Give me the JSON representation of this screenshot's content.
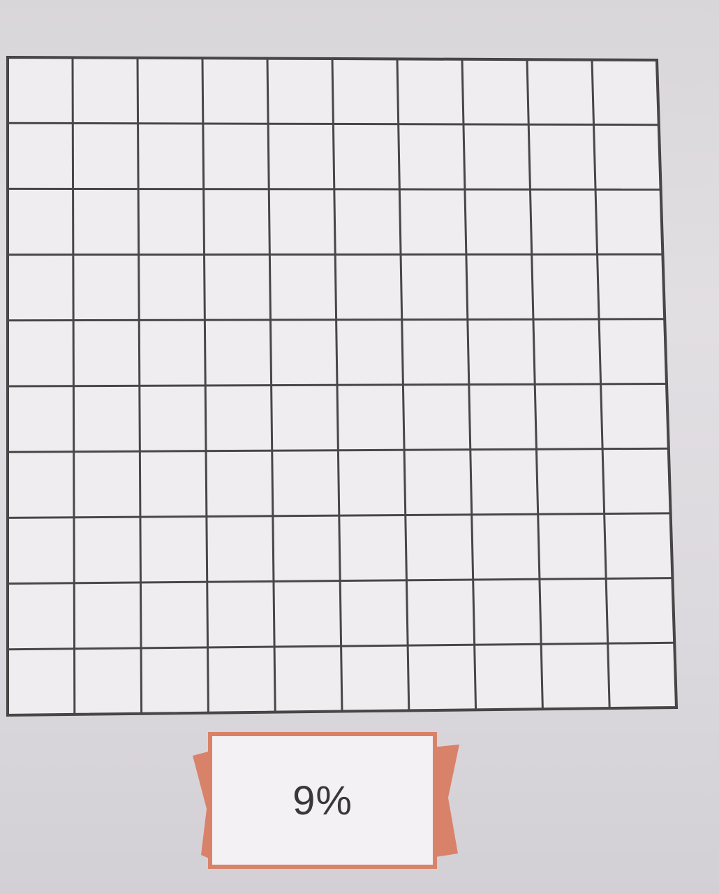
{
  "hundred_grid": {
    "rows": 10,
    "columns": 10,
    "shaded_cells": 0
  },
  "answer_banner": {
    "value": "9%"
  },
  "colors": {
    "page": "#e0dde1",
    "grid_line": "#4a4648",
    "banner_ribbon": "#d9826a",
    "banner_ribbon_dark": "#c66a52",
    "banner_fill": "#f3f1f3",
    "text": "#3b3738"
  }
}
